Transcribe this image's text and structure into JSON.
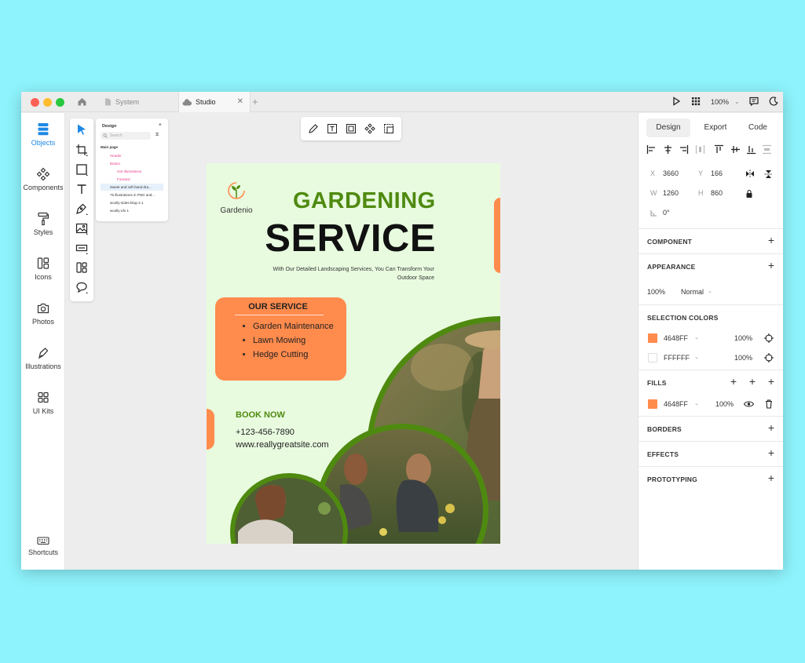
{
  "titlebar": {
    "tabs": [
      {
        "label": "System"
      },
      {
        "label": "Studio"
      }
    ],
    "close": "✕",
    "add": "+",
    "zoom": "100%"
  },
  "sidebar": {
    "items": [
      {
        "label": "Objects",
        "icon": "layers-icon"
      },
      {
        "label": "Components",
        "icon": "components-icon"
      },
      {
        "label": "Styles",
        "icon": "paint-roller-icon"
      },
      {
        "label": "Icons",
        "icon": "icons-icon"
      },
      {
        "label": "Photos",
        "icon": "camera-icon"
      },
      {
        "label": "Illustrations",
        "icon": "pen-nib-icon"
      },
      {
        "label": "UI Kits",
        "icon": "ui-kits-icon"
      },
      {
        "label": "Shortcuts",
        "icon": "keyboard-icon"
      }
    ],
    "active_color": "#1e88e5"
  },
  "layers": {
    "header": "Design",
    "plus": "+",
    "search_placeholder": "Search",
    "rows": [
      "Main page",
      "Header",
      "Button",
      "Get Illustrations",
      "Forward",
      "Sweet and soft hand-dra...",
      "75 illustrations in PNG and...",
      "woolly-sides-blog-1-1",
      "woolly-ufo 1"
    ]
  },
  "poster": {
    "logo_name": "Gardenio",
    "title1": "GARDENING",
    "title2": "SERVICE",
    "subtitle_line1": "With Our Detailed Landscaping Services, You Can Transform Your",
    "subtitle_line2": "Outdoor Space",
    "service_title": "OUR SERVICE",
    "services": [
      "Garden Maintenance",
      "Lawn Mowing",
      "Hedge Cutting"
    ],
    "book_now": "BOOK NOW",
    "phone": "+123-456-7890",
    "website": "www.reallygreatsite.com",
    "colors": {
      "orange": "#ff8b4d",
      "green": "#4f8a10",
      "bg": "#e8fbdf"
    }
  },
  "right_panel": {
    "tabs": [
      "Design",
      "Export",
      "Code"
    ],
    "x_label": "X",
    "x": "3660",
    "y_label": "Y",
    "y": "166",
    "w_label": "W",
    "w": "1260",
    "h_label": "H",
    "h": "860",
    "rotation": "0°",
    "component": "COMPONENT",
    "appearance": "APPEARANCE",
    "opacity": "100%",
    "blend": "Normal",
    "selection_colors": "SELECTION COLORS",
    "sel_colors": [
      {
        "hex": "4648FF",
        "opacity": "100%",
        "swatch": "#ff8b4d"
      },
      {
        "hex": "FFFFFF",
        "opacity": "100%",
        "swatch": "#ffffff"
      }
    ],
    "fills": "FILLS",
    "fill": {
      "hex": "4648FF",
      "opacity": "100%",
      "swatch": "#ff8b4d"
    },
    "borders": "BORDERS",
    "effects": "EFFECTS",
    "prototyping": "PROTOTYPING",
    "plus": "+"
  }
}
